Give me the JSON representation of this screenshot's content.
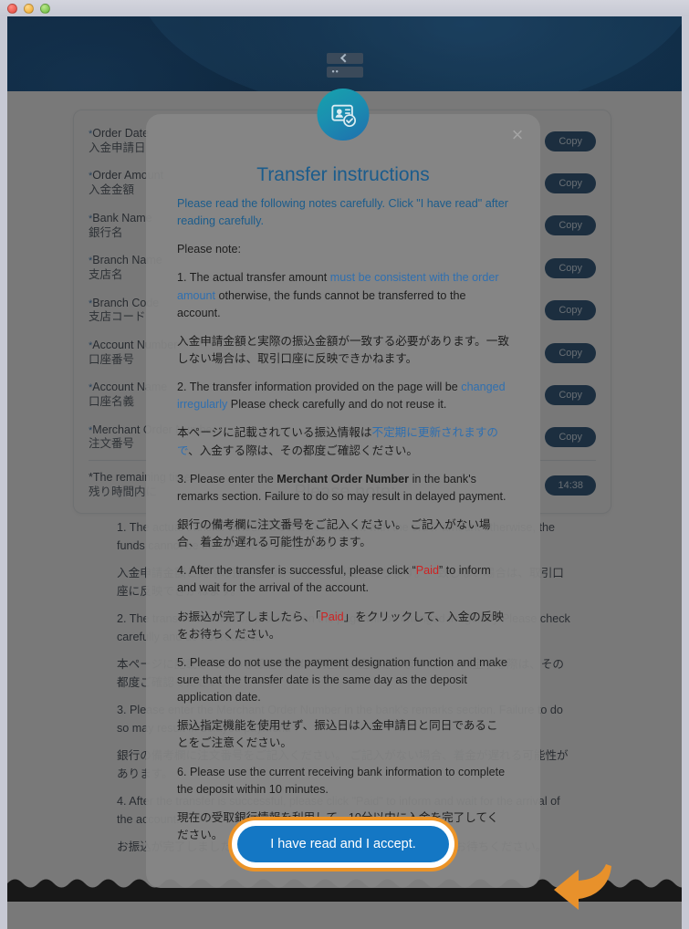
{
  "window": {
    "traffic_lights": [
      "close",
      "minimize",
      "zoom"
    ]
  },
  "header": {
    "logo_name": "bank-card-logo",
    "badge_icon": "id-card-verified-icon"
  },
  "payment_card": {
    "copy_label": "Copy",
    "timer": "14:38",
    "fields": [
      {
        "en": "Order Date",
        "jp": "入金申請日",
        "value": "",
        "required": true
      },
      {
        "en": "Order Amount",
        "jp": "入金金額",
        "value": "",
        "required": true
      },
      {
        "en": "Bank Name",
        "jp": "銀行名",
        "value": "",
        "required": true
      },
      {
        "en": "Branch Name",
        "jp": "支店名",
        "value": "",
        "required": true
      },
      {
        "en": "Branch Code",
        "jp": "支店コード",
        "value": "",
        "required": true
      },
      {
        "en": "Account Number",
        "jp": "口座番号",
        "value": "",
        "required": true
      },
      {
        "en": "Account Name",
        "jp": "口座名義",
        "value": "",
        "required": true
      },
      {
        "en": "Merchant Order Number",
        "jp": "注文番号",
        "value": "",
        "required": true
      }
    ],
    "footnote_en": "*The remaining time",
    "footnote_jp": "残り時間内に"
  },
  "background_notes": {
    "title": "Please note:",
    "items": [
      "1. The actual transfer amount must be consistent with the order amount otherwise, the funds cannot be transferred to the account.",
      "入金申請金額と実際の振込金額が一致する必要があります。一致しない場合は、取引口座に反映できかねます。",
      "2. The transfer information provided on the page will be changed irregularly Please check carefully and do not reuse it.",
      "本ページに記載されている振込情報は不定期に更新されますので、入金する際は、その都度ご確認ください。",
      "3. Please enter the Merchant Order Number in the bank's remarks section. Failure to do so may result in delayed payment.",
      "銀行の備考欄に注文番号をご記入ください。 ご記入がない場合、着金が遅れる可能性があります。",
      "4. After the transfer is successful, please click \"Paid\" to inform and wait for the arrival of the account.",
      "お振込が完了しましたら、「Paid」をクリックして、入金の反映をお待ちください。",
      "5. Please do not use the payment designation function and make sure that the transfer date is the same day as the deposit application date."
    ]
  },
  "modal": {
    "title": "Transfer instructions",
    "close_label": "×",
    "intro": "Please read the following notes carefully. Click \"I have read\" after reading carefully.",
    "please_note": "Please note:",
    "note_1_a": "1. The actual transfer amount ",
    "note_1_link": "must be consistent with the order amount",
    "note_1_b": " otherwise, the funds cannot be transferred to the account.",
    "note_1_jp": "入金申請金額と実際の振込金額が一致する必要があります。一致しない場合は、取引口座に反映できかねます。",
    "note_2_a": "2. The transfer information provided on the page will be ",
    "note_2_link": "changed irregularly",
    "note_2_b": " Please check carefully and do not reuse it.",
    "note_2_jp_a": "本ページに記載されている振込情報は",
    "note_2_jp_link": "不定期に更新されますので",
    "note_2_jp_b": "、入金する際は、その都度ご確認ください。",
    "note_3_a": "3. Please enter the ",
    "note_3_bold": "Merchant Order Number",
    "note_3_b": " in the bank's remarks section. Failure to do so may result in delayed payment.",
    "note_3_jp": "銀行の備考欄に注文番号をご記入ください。 ご記入がない場合、着金が遅れる可能性があります。",
    "note_4_a": "4. After the transfer is successful, please click “",
    "note_4_red": "Paid",
    "note_4_b": "” to inform and wait for the arrival of the account.",
    "note_4_jp_a": "お振込が完了しましたら、「",
    "note_4_jp_red": "Paid",
    "note_4_jp_b": "」をクリックして、入金の反映をお待ちください。",
    "note_5": "5. Please do not use the payment designation function and make sure that the transfer date is the same day as the deposit application date.",
    "note_5_jp": "振込指定機能を使用せず、振込日は入金申請日と同日であることをご注意ください。",
    "note_6": "6. Please use the current receiving bank information to complete the deposit within 10 minutes.",
    "note_6_jp": "現在の受取銀行情報を利用して、10分以内に入金を完了してください。",
    "accept_label": "I have read and I accept.",
    "arrow_icon": "curved-arrow-left-icon"
  },
  "colors": {
    "accent_blue": "#1477c4",
    "title_blue": "#1b5c8c",
    "link_blue": "#2f6fb0",
    "highlight_orange": "#eb9327",
    "alert_red": "#cf2222",
    "header_navy": "#102a43",
    "copy_navy": "#0c3b66"
  }
}
